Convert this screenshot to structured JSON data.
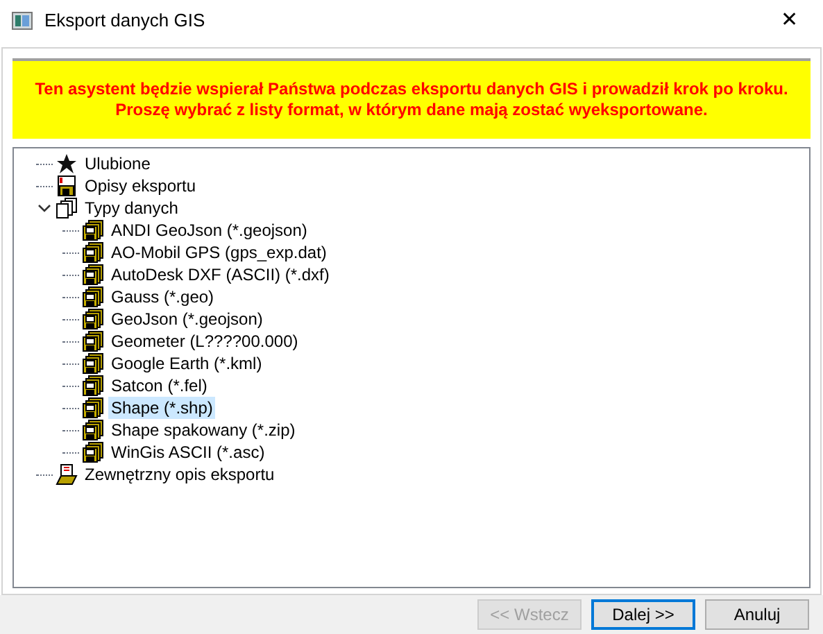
{
  "window": {
    "title": "Eksport danych GIS",
    "close": "✕"
  },
  "banner": {
    "lines": [
      "Ten asystent będzie wspierał Państwa podczas eksportu danych GIS i prowadził krok po kroku.",
      "Proszę wybrać z listy format, w którym dane mają zostać wyeksportowane."
    ]
  },
  "tree": [
    {
      "kind": "star",
      "label": "Ulubione",
      "selected": false
    },
    {
      "kind": "doc",
      "label": "Opisy eksportu",
      "selected": false
    },
    {
      "kind": "folder",
      "label": "Typy danych",
      "selected": false,
      "expanded": true,
      "children": [
        {
          "kind": "format",
          "label": "ANDI GeoJson (*.geojson)",
          "selected": false
        },
        {
          "kind": "format",
          "label": "AO-Mobil GPS (gps_exp.dat)",
          "selected": false
        },
        {
          "kind": "format",
          "label": "AutoDesk DXF (ASCII) (*.dxf)",
          "selected": false
        },
        {
          "kind": "format",
          "label": "Gauss (*.geo)",
          "selected": false
        },
        {
          "kind": "format",
          "label": "GeoJson (*.geojson)",
          "selected": false
        },
        {
          "kind": "format",
          "label": "Geometer (L????00.000)",
          "selected": false
        },
        {
          "kind": "format",
          "label": "Google Earth (*.kml)",
          "selected": false
        },
        {
          "kind": "format",
          "label": "Satcon (*.fel)",
          "selected": false
        },
        {
          "kind": "format",
          "label": "Shape (*.shp)",
          "selected": true
        },
        {
          "kind": "format",
          "label": "Shape spakowany (*.zip)",
          "selected": false
        },
        {
          "kind": "format",
          "label": "WinGis ASCII (*.asc)",
          "selected": false
        }
      ]
    },
    {
      "kind": "external",
      "label": "Zewnętrzny opis eksportu",
      "selected": false
    }
  ],
  "buttons": [
    {
      "label": "<< Wstecz",
      "disabled": true,
      "focused": false
    },
    {
      "label": "Dalej >>",
      "disabled": false,
      "focused": true
    },
    {
      "label": "Anuluj",
      "disabled": false,
      "focused": false
    }
  ]
}
